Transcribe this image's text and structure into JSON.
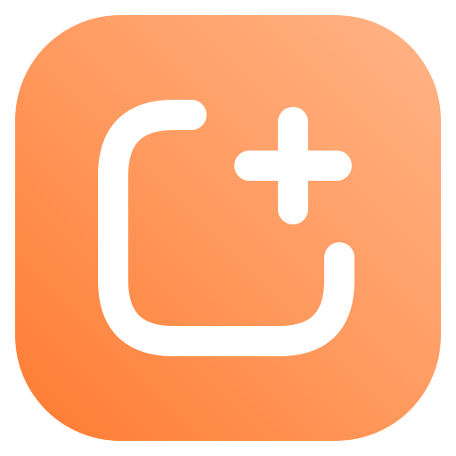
{
  "icon": {
    "name": "add-app-icon",
    "glyph": "square-plus-icon",
    "colors": {
      "gradient_light": "#FFB487",
      "gradient_mid": "#FF9A5F",
      "gradient_dark": "#FF7A30",
      "glyph": "#FFFFFF"
    }
  }
}
